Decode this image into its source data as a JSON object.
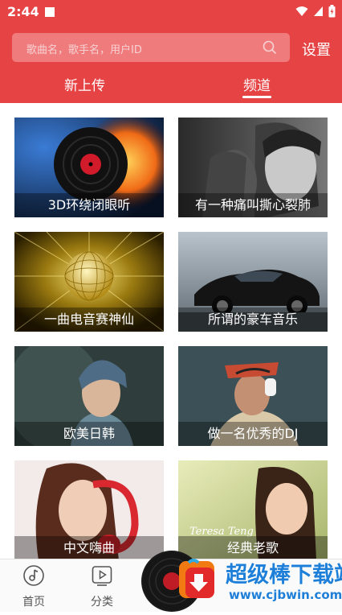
{
  "status_bar": {
    "time": "2:44"
  },
  "search": {
    "placeholder": "歌曲名，歌手名，用户ID"
  },
  "header": {
    "settings_label": "设置"
  },
  "tabs": [
    {
      "label": "新上传",
      "active": false
    },
    {
      "label": "频道",
      "active": true
    }
  ],
  "channels": [
    {
      "label": "3D环绕闭眼听"
    },
    {
      "label": "有一种痛叫撕心裂肺"
    },
    {
      "label": "一曲电音赛神仙"
    },
    {
      "label": "所谓的豪车音乐"
    },
    {
      "label": "欧美日韩"
    },
    {
      "label": "做一名优秀的DJ"
    },
    {
      "label": "中文嗨曲"
    },
    {
      "label": "经典老歌",
      "overlay_text": "Teresa Teng"
    }
  ],
  "bottom_nav": [
    {
      "label": "首页",
      "icon": "music-note-icon"
    },
    {
      "label": "分类",
      "icon": "play-square-icon"
    }
  ],
  "watermark": {
    "title": "超级棒下载站",
    "url": "www.cjbwin.com"
  },
  "colors": {
    "brand": "#e64345",
    "search_bg": "#ef7b7d"
  }
}
